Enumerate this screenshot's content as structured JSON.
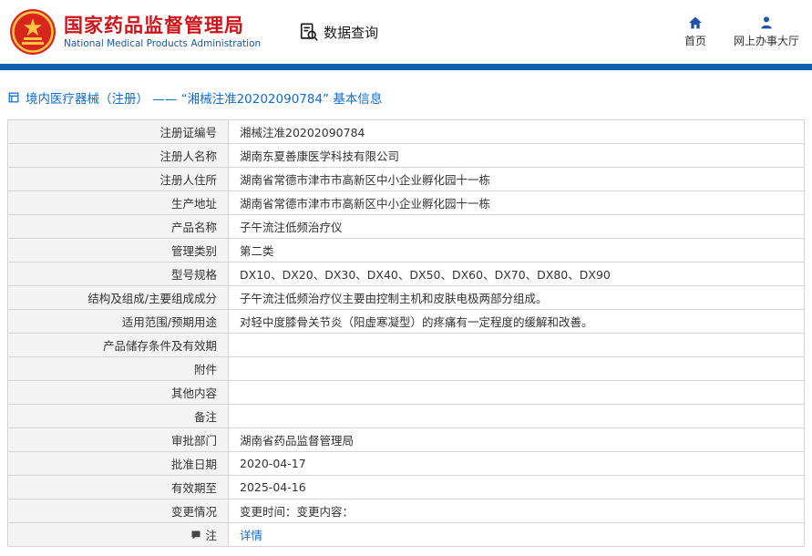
{
  "header": {
    "agency_cn": "国家药品监督管理局",
    "agency_en": "National Medical Products Administration",
    "nav_query": "数据查询",
    "nav_home": "首页",
    "nav_hall": "网上办事大厅"
  },
  "breadcrumb": {
    "text": "境内医疗器械（注册） —— “湘械注准20202090784” 基本信息"
  },
  "icons": {
    "emblem": "national-emblem",
    "query": "document-magnifier-icon",
    "home": "home-icon",
    "hall": "person-icon",
    "breadcrumb": "building-icon",
    "note": "comment-icon"
  },
  "colors": {
    "accent_red": "#d01318",
    "accent_blue": "#1a57a8",
    "bar_blue": "#0f5fae",
    "link_blue": "#0a6cd6",
    "label_bg": "#f4f4f4",
    "border": "#d4d4d4"
  },
  "table": {
    "rows": [
      {
        "label": "注册证编号",
        "value": "湘械注准20202090784"
      },
      {
        "label": "注册人名称",
        "value": "湖南东夏善康医学科技有限公司"
      },
      {
        "label": "注册人住所",
        "value": "湖南省常德市津市市高新区中小企业孵化园十一栋"
      },
      {
        "label": "生产地址",
        "value": "湖南省常德市津市市高新区中小企业孵化园十一栋"
      },
      {
        "label": "产品名称",
        "value": "子午流注低频治疗仪"
      },
      {
        "label": "管理类别",
        "value": "第二类"
      },
      {
        "label": "型号规格",
        "value": "DX10、DX20、DX30、DX40、DX50、DX60、DX70、DX80、DX90"
      },
      {
        "label": "结构及组成/主要组成成分",
        "value": "子午流注低频治疗仪主要由控制主机和皮肤电极两部分组成。"
      },
      {
        "label": "适用范围/预期用途",
        "value": "对轻中度膝骨关节炎（阳虚寒凝型）的疼痛有一定程度的缓解和改善。"
      },
      {
        "label": "产品储存条件及有效期",
        "value": ""
      },
      {
        "label": "附件",
        "value": ""
      },
      {
        "label": "其他内容",
        "value": ""
      },
      {
        "label": "备注",
        "value": ""
      },
      {
        "label": "审批部门",
        "value": "湖南省药品监督管理局"
      },
      {
        "label": "批准日期",
        "value": "2020-04-17"
      },
      {
        "label": "有效期至",
        "value": "2025-04-16"
      },
      {
        "label": "变更情况",
        "value": "变更时间：变更内容："
      },
      {
        "label": "注",
        "value": "详情"
      }
    ]
  }
}
